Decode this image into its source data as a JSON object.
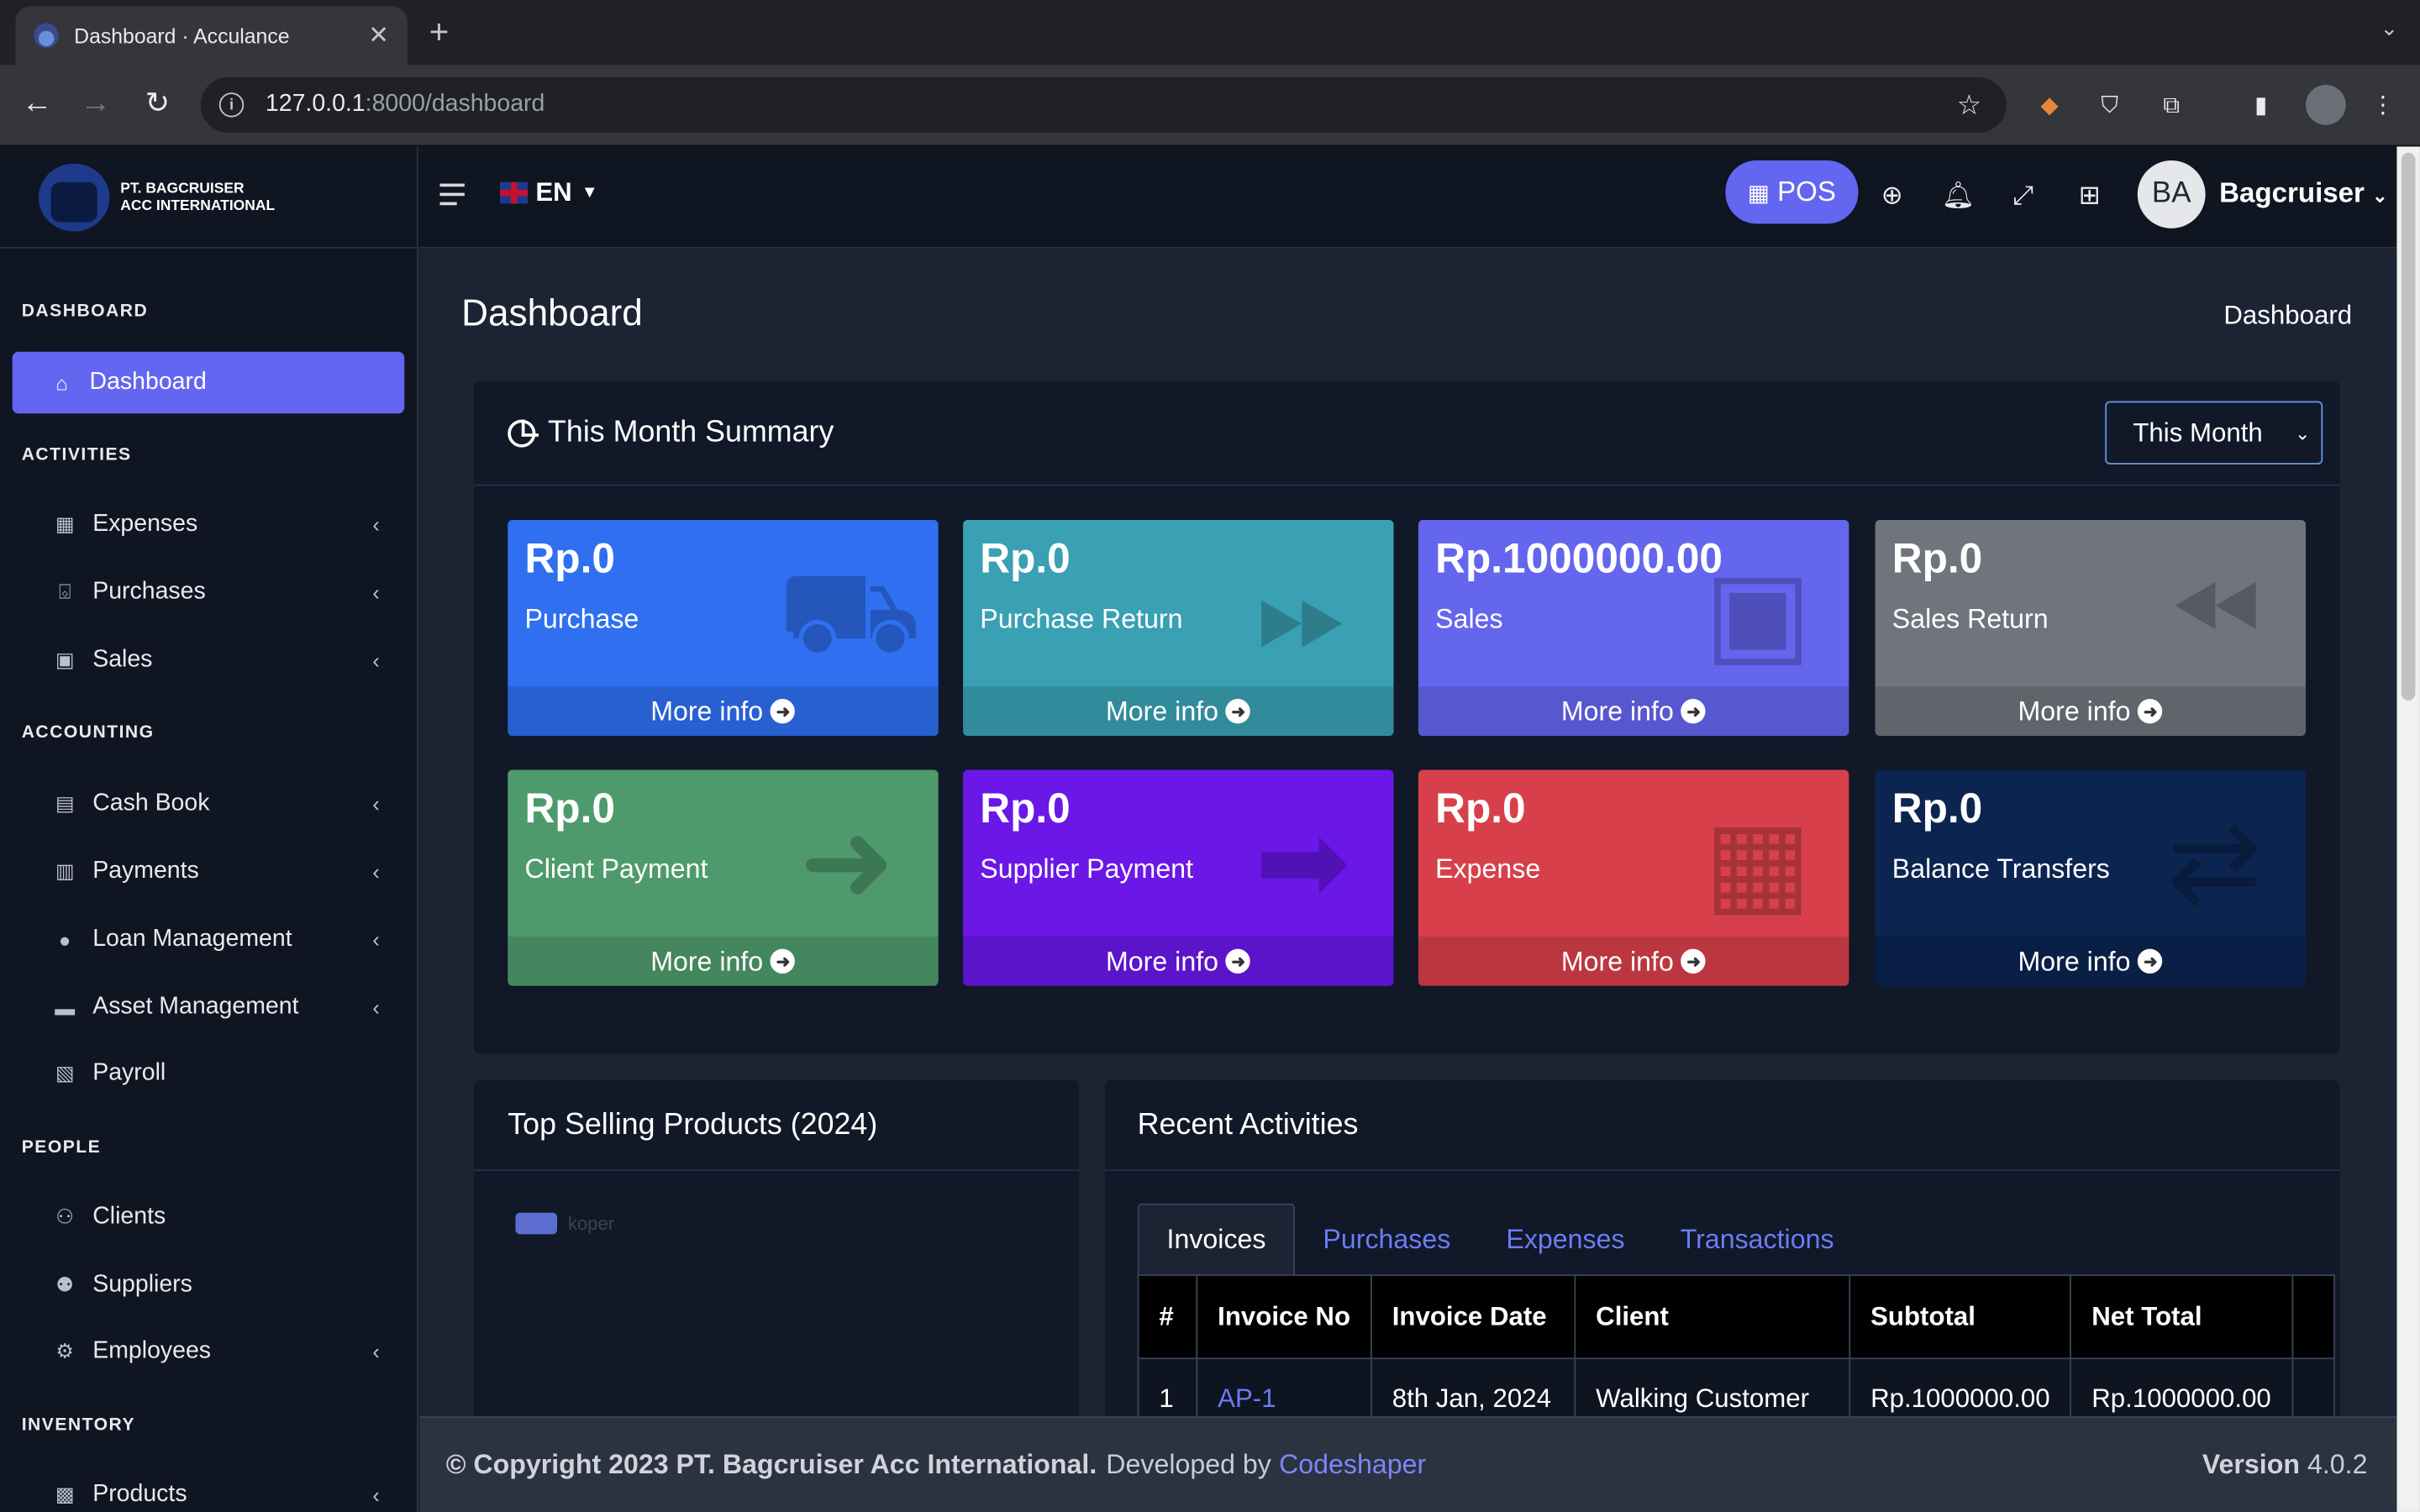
{
  "browser": {
    "tab_title": "Dashboard · Acculance",
    "url_host": "127.0.0.1",
    "url_path": ":8000/dashboard"
  },
  "brand": {
    "line1": "PT. BAGCRUISER",
    "line2": "ACC INTERNATIONAL"
  },
  "sidebar": {
    "sections": {
      "dashboard": "DASHBOARD",
      "activities": "ACTIVITIES",
      "accounting": "ACCOUNTING",
      "people": "PEOPLE",
      "inventory": "INVENTORY"
    },
    "items": [
      {
        "label": "Dashboard",
        "icon": "home-icon"
      },
      {
        "label": "Expenses",
        "icon": "calculator-icon"
      },
      {
        "label": "Purchases",
        "icon": "basket-icon"
      },
      {
        "label": "Sales",
        "icon": "shopping-bag-icon"
      },
      {
        "label": "Cash Book",
        "icon": "book-icon"
      },
      {
        "label": "Payments",
        "icon": "receipt-icon"
      },
      {
        "label": "Loan Management",
        "icon": "piggy-bank-icon"
      },
      {
        "label": "Asset Management",
        "icon": "couch-icon"
      },
      {
        "label": "Payroll",
        "icon": "clipboard-icon"
      },
      {
        "label": "Clients",
        "icon": "users-icon"
      },
      {
        "label": "Suppliers",
        "icon": "people-carry-icon"
      },
      {
        "label": "Employees",
        "icon": "users-cog-icon"
      },
      {
        "label": "Products",
        "icon": "cubes-icon"
      }
    ]
  },
  "header": {
    "lang": "EN",
    "pos_label": "POS",
    "avatar_initials": "BA",
    "user_name": "Bagcruiser"
  },
  "page": {
    "title": "Dashboard",
    "breadcrumb": "Dashboard"
  },
  "summary": {
    "title": "This Month Summary",
    "period": "This Month",
    "more_info": "More info",
    "boxes": [
      {
        "value": "Rp.0",
        "label": "Purchase",
        "color": "#2f6ff0",
        "icon": "dolly-icon"
      },
      {
        "value": "Rp.0",
        "label": "Purchase Return",
        "color": "#3aa0b3",
        "icon": "forward-icon"
      },
      {
        "value": "Rp.1000000.00",
        "label": "Sales",
        "color": "#6466ee",
        "icon": "shopping-bag-icon"
      },
      {
        "value": "Rp.0",
        "label": "Sales Return",
        "color": "#6f747d",
        "icon": "backward-icon"
      },
      {
        "value": "Rp.0",
        "label": "Client Payment",
        "color": "#4f9a6c",
        "icon": "sign-in-icon"
      },
      {
        "value": "Rp.0",
        "label": "Supplier Payment",
        "color": "#6a17e8",
        "icon": "share-square-icon"
      },
      {
        "value": "Rp.0",
        "label": "Expense",
        "color": "#d7404a",
        "icon": "calculator-icon"
      },
      {
        "value": "Rp.0",
        "label": "Balance Transfers",
        "color": "#0c2450",
        "icon": "exchange-icon"
      }
    ]
  },
  "top_selling": {
    "title": "Top Selling Products (2024)",
    "legend": "koper"
  },
  "recent": {
    "title": "Recent Activities",
    "tabs": [
      "Invoices",
      "Purchases",
      "Expenses",
      "Transactions"
    ],
    "columns": [
      "#",
      "Invoice No",
      "Invoice Date",
      "Client",
      "Subtotal",
      "Net Total"
    ],
    "rows": [
      [
        "1",
        "AP-1",
        "8th Jan, 2024",
        "Walking Customer",
        "Rp.1000000.00",
        "Rp.1000000.00"
      ]
    ]
  },
  "footer": {
    "copyright": "© Copyright 2023 PT. Bagcruiser Acc International.",
    "developed_by": "Developed by",
    "developer": "Codeshaper",
    "version_label": "Version",
    "version": "4.0.2"
  }
}
